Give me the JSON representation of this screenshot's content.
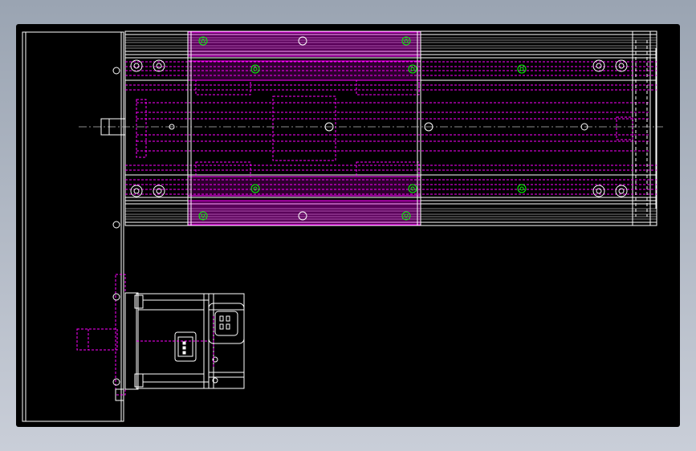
{
  "viewport": {
    "background": "#000000",
    "frame_background": "#a8b0bc"
  },
  "colors": {
    "outline": "#ffffff",
    "hidden_line": "#ff00ff",
    "center_line": "#bbbbbb",
    "bolt": "#00ff00"
  },
  "labels": {
    "top_rail_mark": "",
    "bottom_rail_mark": ""
  }
}
